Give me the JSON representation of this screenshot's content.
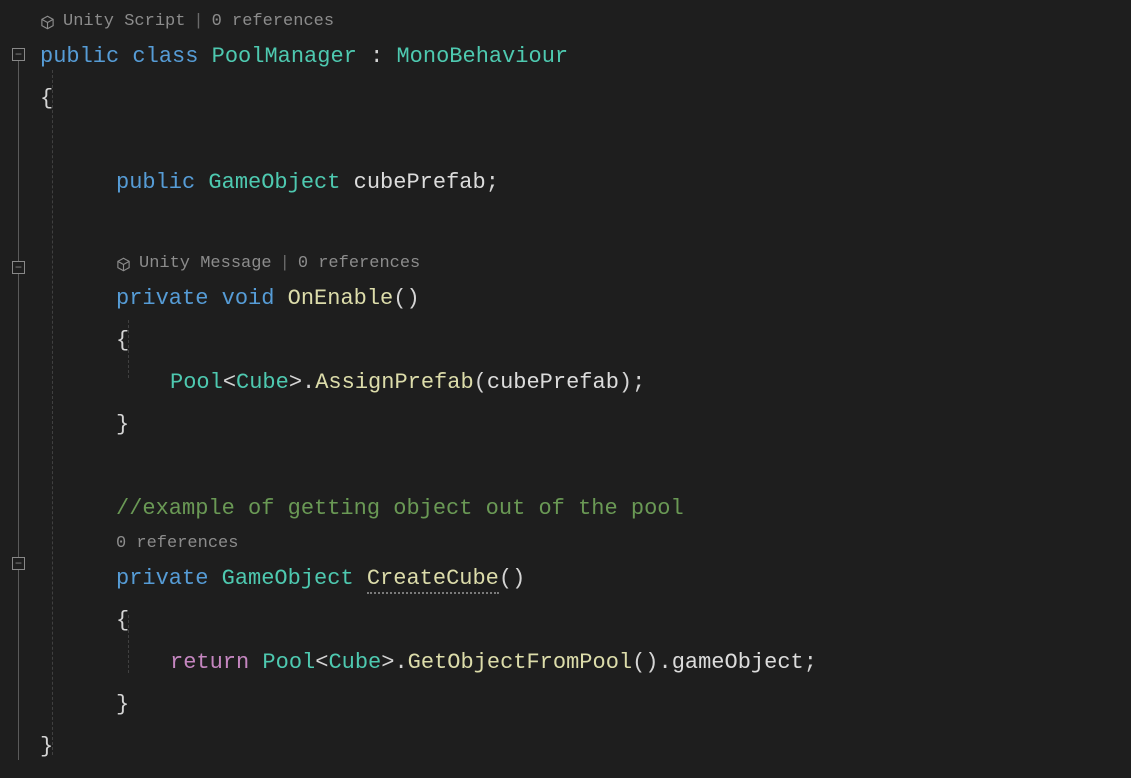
{
  "codelens": {
    "class": {
      "label": "Unity Script",
      "refs": "0 references"
    },
    "onEnable": {
      "label": "Unity Message",
      "refs": "0 references"
    },
    "createCube": {
      "refs": "0 references"
    }
  },
  "tokens": {
    "public": "public",
    "class": "class",
    "private": "private",
    "void": "void",
    "return": "return",
    "PoolManager": "PoolManager",
    "MonoBehaviour": "MonoBehaviour",
    "GameObject": "GameObject",
    "cubePrefab": "cubePrefab",
    "OnEnable": "OnEnable",
    "Pool": "Pool",
    "Cube": "Cube",
    "AssignPrefab": "AssignPrefab",
    "CreateCube": "CreateCube",
    "GetObjectFromPool": "GetObjectFromPool",
    "gameObject": "gameObject",
    "comment_pool": "//example of getting object out of the pool"
  },
  "punct": {
    "colon": " : ",
    "lbrace": "{",
    "rbrace": "}",
    "lparen": "(",
    "rparen": ")",
    "semi": ";",
    "lt": "<",
    "gt": ">",
    "dot": "."
  }
}
